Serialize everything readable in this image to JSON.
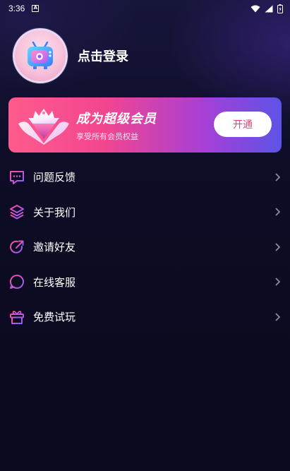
{
  "status_bar": {
    "time": "3:36",
    "notification_icon": "a-notification-icon",
    "icons": [
      "wifi-icon",
      "signal-icon",
      "battery-icon"
    ]
  },
  "profile": {
    "avatar_icon": "tv-avatar-icon",
    "login_label": "点击登录"
  },
  "vip_banner": {
    "title": "成为超级会员",
    "subtitle": "享受所有会员权益",
    "button_label": "开通",
    "gradient": [
      "#ff5b8d",
      "#a63fd6",
      "#5d53e6"
    ]
  },
  "menu": {
    "items": [
      {
        "label": "问题反馈",
        "icon": "feedback-chat-icon"
      },
      {
        "label": "关于我们",
        "icon": "layers-icon"
      },
      {
        "label": "邀请好友",
        "icon": "share-arrow-icon"
      },
      {
        "label": "在线客服",
        "icon": "customer-service-chat-icon"
      },
      {
        "label": "免费试玩",
        "icon": "gift-icon"
      }
    ]
  },
  "colors": {
    "background": "#0b0a1f",
    "accent_pink": "#e0407f",
    "icon_gradient_start": "#ff4fa0",
    "icon_gradient_end": "#8a5cff",
    "chevron": "#8e8ca3"
  }
}
